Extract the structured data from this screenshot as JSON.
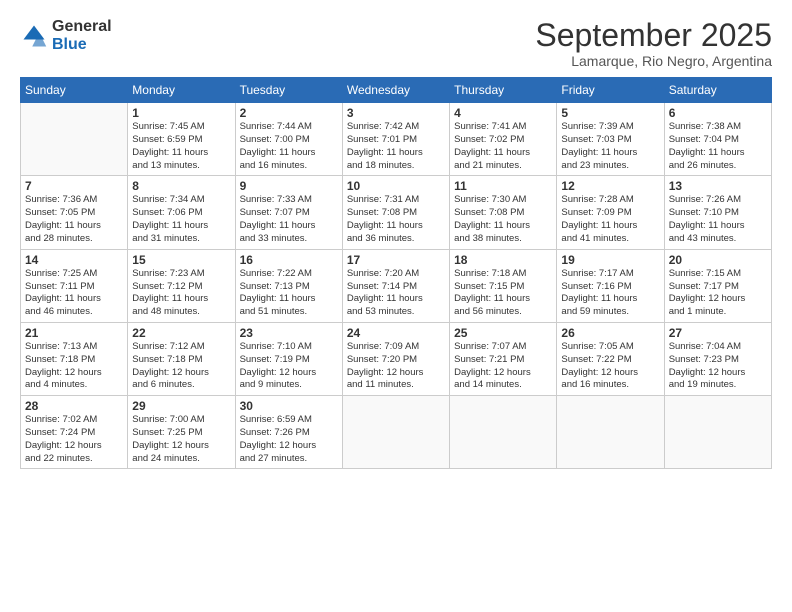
{
  "logo": {
    "general": "General",
    "blue": "Blue"
  },
  "title": "September 2025",
  "location": "Lamarque, Rio Negro, Argentina",
  "headers": [
    "Sunday",
    "Monday",
    "Tuesday",
    "Wednesday",
    "Thursday",
    "Friday",
    "Saturday"
  ],
  "weeks": [
    [
      {
        "day": "",
        "info": ""
      },
      {
        "day": "1",
        "info": "Sunrise: 7:45 AM\nSunset: 6:59 PM\nDaylight: 11 hours\nand 13 minutes."
      },
      {
        "day": "2",
        "info": "Sunrise: 7:44 AM\nSunset: 7:00 PM\nDaylight: 11 hours\nand 16 minutes."
      },
      {
        "day": "3",
        "info": "Sunrise: 7:42 AM\nSunset: 7:01 PM\nDaylight: 11 hours\nand 18 minutes."
      },
      {
        "day": "4",
        "info": "Sunrise: 7:41 AM\nSunset: 7:02 PM\nDaylight: 11 hours\nand 21 minutes."
      },
      {
        "day": "5",
        "info": "Sunrise: 7:39 AM\nSunset: 7:03 PM\nDaylight: 11 hours\nand 23 minutes."
      },
      {
        "day": "6",
        "info": "Sunrise: 7:38 AM\nSunset: 7:04 PM\nDaylight: 11 hours\nand 26 minutes."
      }
    ],
    [
      {
        "day": "7",
        "info": "Sunrise: 7:36 AM\nSunset: 7:05 PM\nDaylight: 11 hours\nand 28 minutes."
      },
      {
        "day": "8",
        "info": "Sunrise: 7:34 AM\nSunset: 7:06 PM\nDaylight: 11 hours\nand 31 minutes."
      },
      {
        "day": "9",
        "info": "Sunrise: 7:33 AM\nSunset: 7:07 PM\nDaylight: 11 hours\nand 33 minutes."
      },
      {
        "day": "10",
        "info": "Sunrise: 7:31 AM\nSunset: 7:08 PM\nDaylight: 11 hours\nand 36 minutes."
      },
      {
        "day": "11",
        "info": "Sunrise: 7:30 AM\nSunset: 7:08 PM\nDaylight: 11 hours\nand 38 minutes."
      },
      {
        "day": "12",
        "info": "Sunrise: 7:28 AM\nSunset: 7:09 PM\nDaylight: 11 hours\nand 41 minutes."
      },
      {
        "day": "13",
        "info": "Sunrise: 7:26 AM\nSunset: 7:10 PM\nDaylight: 11 hours\nand 43 minutes."
      }
    ],
    [
      {
        "day": "14",
        "info": "Sunrise: 7:25 AM\nSunset: 7:11 PM\nDaylight: 11 hours\nand 46 minutes."
      },
      {
        "day": "15",
        "info": "Sunrise: 7:23 AM\nSunset: 7:12 PM\nDaylight: 11 hours\nand 48 minutes."
      },
      {
        "day": "16",
        "info": "Sunrise: 7:22 AM\nSunset: 7:13 PM\nDaylight: 11 hours\nand 51 minutes."
      },
      {
        "day": "17",
        "info": "Sunrise: 7:20 AM\nSunset: 7:14 PM\nDaylight: 11 hours\nand 53 minutes."
      },
      {
        "day": "18",
        "info": "Sunrise: 7:18 AM\nSunset: 7:15 PM\nDaylight: 11 hours\nand 56 minutes."
      },
      {
        "day": "19",
        "info": "Sunrise: 7:17 AM\nSunset: 7:16 PM\nDaylight: 11 hours\nand 59 minutes."
      },
      {
        "day": "20",
        "info": "Sunrise: 7:15 AM\nSunset: 7:17 PM\nDaylight: 12 hours\nand 1 minute."
      }
    ],
    [
      {
        "day": "21",
        "info": "Sunrise: 7:13 AM\nSunset: 7:18 PM\nDaylight: 12 hours\nand 4 minutes."
      },
      {
        "day": "22",
        "info": "Sunrise: 7:12 AM\nSunset: 7:18 PM\nDaylight: 12 hours\nand 6 minutes."
      },
      {
        "day": "23",
        "info": "Sunrise: 7:10 AM\nSunset: 7:19 PM\nDaylight: 12 hours\nand 9 minutes."
      },
      {
        "day": "24",
        "info": "Sunrise: 7:09 AM\nSunset: 7:20 PM\nDaylight: 12 hours\nand 11 minutes."
      },
      {
        "day": "25",
        "info": "Sunrise: 7:07 AM\nSunset: 7:21 PM\nDaylight: 12 hours\nand 14 minutes."
      },
      {
        "day": "26",
        "info": "Sunrise: 7:05 AM\nSunset: 7:22 PM\nDaylight: 12 hours\nand 16 minutes."
      },
      {
        "day": "27",
        "info": "Sunrise: 7:04 AM\nSunset: 7:23 PM\nDaylight: 12 hours\nand 19 minutes."
      }
    ],
    [
      {
        "day": "28",
        "info": "Sunrise: 7:02 AM\nSunset: 7:24 PM\nDaylight: 12 hours\nand 22 minutes."
      },
      {
        "day": "29",
        "info": "Sunrise: 7:00 AM\nSunset: 7:25 PM\nDaylight: 12 hours\nand 24 minutes."
      },
      {
        "day": "30",
        "info": "Sunrise: 6:59 AM\nSunset: 7:26 PM\nDaylight: 12 hours\nand 27 minutes."
      },
      {
        "day": "",
        "info": ""
      },
      {
        "day": "",
        "info": ""
      },
      {
        "day": "",
        "info": ""
      },
      {
        "day": "",
        "info": ""
      }
    ]
  ]
}
